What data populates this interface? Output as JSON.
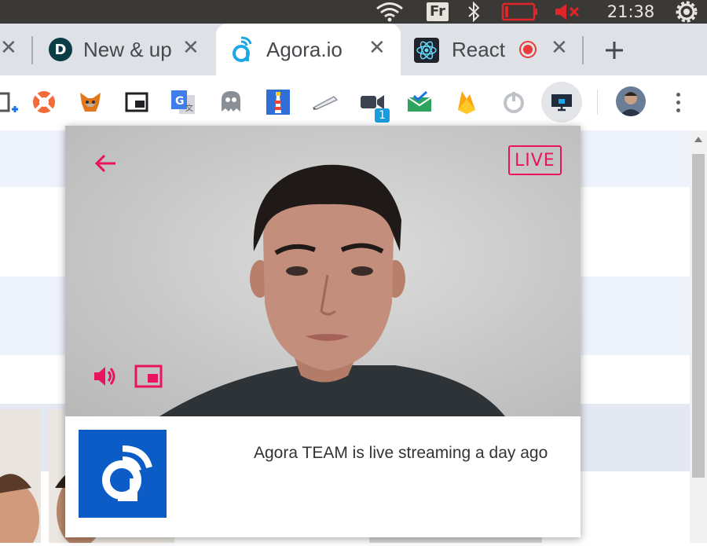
{
  "system_bar": {
    "keyboard_layout": "Fr",
    "time": "21:38",
    "icons": [
      "wifi-icon",
      "bluetooth-icon",
      "battery-icon",
      "volume-muted-icon",
      "power-icon"
    ]
  },
  "tabs": [
    {
      "title": "New & up",
      "icon": "d-logo-icon",
      "active": false
    },
    {
      "title": "Agora.io",
      "icon": "agora-icon",
      "active": true
    },
    {
      "title": "React",
      "icon": "react-icon",
      "active": false,
      "recording": true
    }
  ],
  "toolbar": {
    "extensions": [
      "lifebuoy-icon",
      "metamask-icon",
      "picture-in-picture-icon",
      "google-translate-icon",
      "ghostery-icon",
      "lighthouse-icon",
      "pen-icon",
      "video-camera-icon",
      "mail-check-icon",
      "firebase-icon",
      "power-circle-icon",
      "screen-share-icon"
    ],
    "extension_badge": "1"
  },
  "popup": {
    "live_label": "LIVE",
    "info_text": "Agora TEAM is live streaming a day ago",
    "accent_color": "#e8145f",
    "logo_color": "#0b5cc6"
  }
}
